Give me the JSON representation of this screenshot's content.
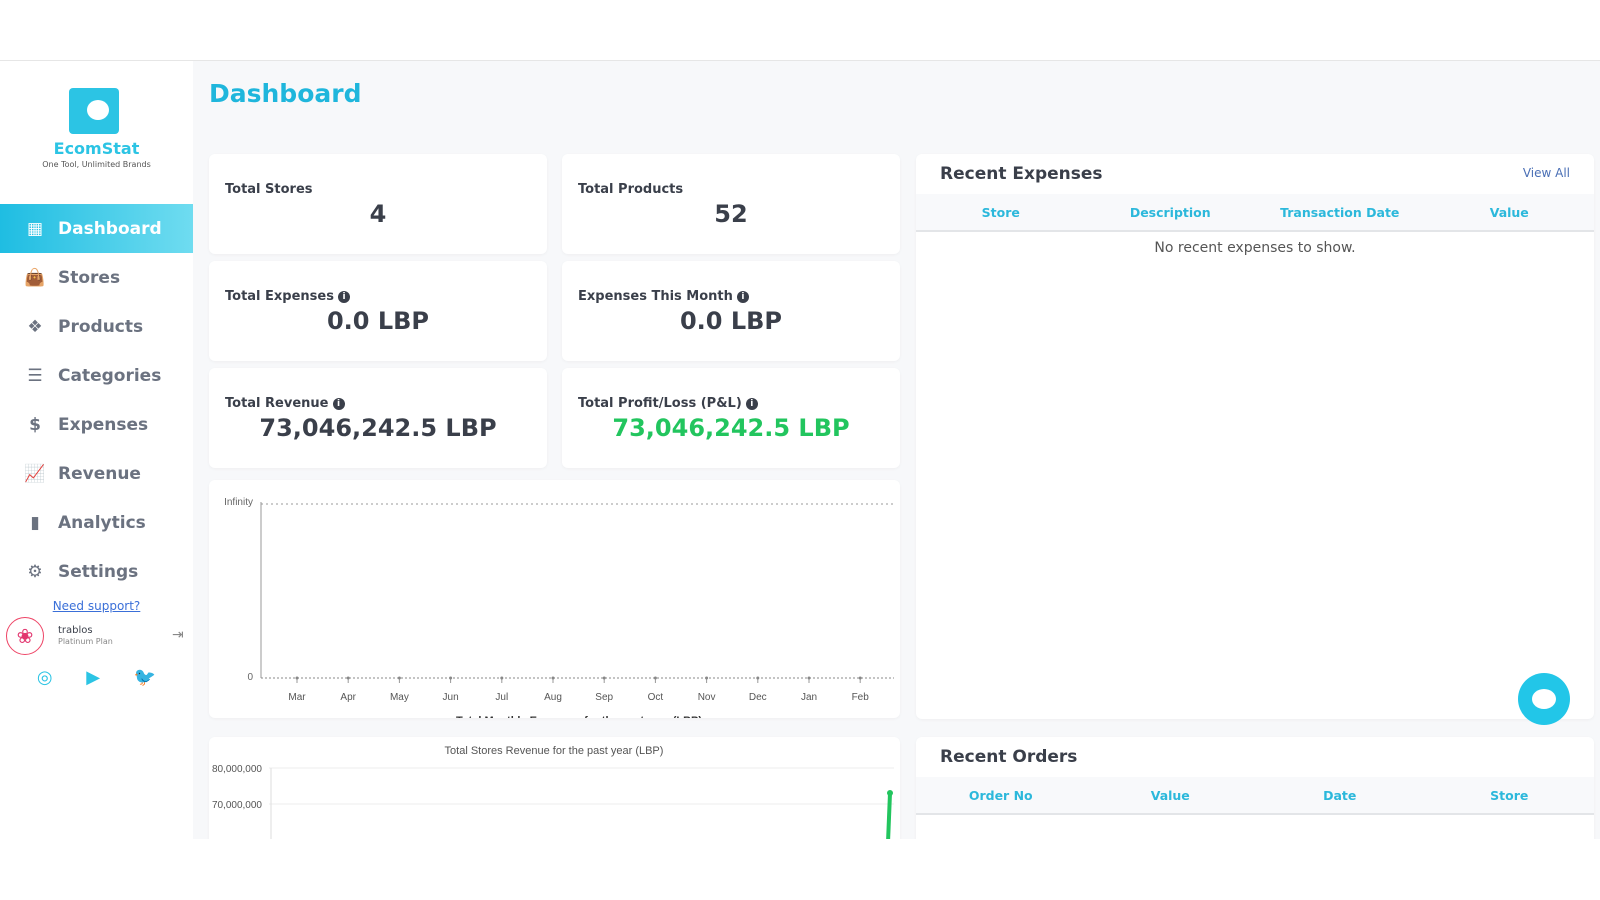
{
  "brand": {
    "name": "EcomStat",
    "tagline": "One Tool, Unlimited Brands"
  },
  "nav": [
    {
      "label": "Dashboard",
      "icon": "grid-icon",
      "active": true
    },
    {
      "label": "Stores",
      "icon": "shopping-bag-icon"
    },
    {
      "label": "Products",
      "icon": "dropbox-icon"
    },
    {
      "label": "Categories",
      "icon": "list-icon"
    },
    {
      "label": "Expenses",
      "icon": "dollar-icon"
    },
    {
      "label": "Revenue",
      "icon": "line-chart-icon"
    },
    {
      "label": "Analytics",
      "icon": "bar-chart-icon"
    },
    {
      "label": "Settings",
      "icon": "gear-icon"
    }
  ],
  "support": "Need support?",
  "user": {
    "name": "trablos",
    "plan": "Platinum Plan"
  },
  "page_title": "Dashboard",
  "stats": [
    {
      "label": "Total Stores",
      "value": "4"
    },
    {
      "label": "Total Products",
      "value": "52"
    },
    {
      "label": "Total Expenses",
      "value": "0.0 LBP"
    },
    {
      "label": "Expenses This Month",
      "value": "0.0 LBP"
    },
    {
      "label": "Total Revenue",
      "value": "73,046,242.5 LBP"
    },
    {
      "label": "Total Profit/Loss (P&L)",
      "value": "73,046,242.5 LBP",
      "color": "#22c55e"
    }
  ],
  "recent_expenses": {
    "title": "Recent Expenses",
    "view_all": "View All",
    "columns": [
      "Store",
      "Description",
      "Transaction Date",
      "Value"
    ],
    "empty": "No recent expenses to show."
  },
  "recent_orders": {
    "title": "Recent Orders",
    "columns": [
      "Order No",
      "Value",
      "Date",
      "Store"
    ]
  },
  "chart_data": [
    {
      "type": "line",
      "title": "Total Monthly Expenses for the past year (LBP)",
      "categories": [
        "Mar",
        "Apr",
        "May",
        "Jun",
        "Jul",
        "Aug",
        "Sep",
        "Oct",
        "Nov",
        "Dec",
        "Jan",
        "Feb"
      ],
      "values": [
        0,
        0,
        0,
        0,
        0,
        0,
        0,
        0,
        0,
        0,
        0,
        0
      ],
      "yticks": [
        "0",
        "Infinity"
      ]
    },
    {
      "type": "line",
      "title": "Total Stores Revenue for the past year (LBP)",
      "yticks": [
        "80,000,000",
        "70,000,000"
      ],
      "last_value": 73046242.5,
      "color": "#22c55e"
    }
  ]
}
